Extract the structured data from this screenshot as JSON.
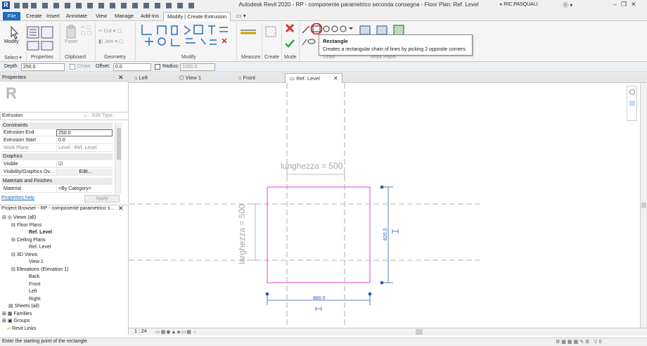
{
  "app": {
    "title": "Autodesk Revit 2020 - RP - componente parametrico seconda consegna - Floor Plan: Ref. Level",
    "user": "RIC.PASQUALI",
    "accent": "#1a6fc0"
  },
  "tabs": [
    "File",
    "Create",
    "Insert",
    "Annotate",
    "View",
    "Manage",
    "Add-Ins",
    "Modify | Create Extrusion"
  ],
  "ribbon": {
    "panels": [
      "Select",
      "Properties",
      "Clipboard",
      "Geometry",
      "Modify",
      "Measure",
      "Create",
      "Mode",
      "Draw",
      "Work Plane"
    ],
    "modify_label": "Modify",
    "properties_label": "Properties",
    "paste_label": "Paste",
    "cut_label": "Cut",
    "join_label": "Join"
  },
  "tooltip": {
    "title": "Rectangle",
    "text": "Creates a rectangular chain of lines by picking 2 opposite corners."
  },
  "options_bar": {
    "depth_label": "Depth",
    "depth_value": "250.0",
    "chain_label": "Chain",
    "offset_label": "Offset:",
    "offset_value": "0.0",
    "radius_label": "Radius:",
    "radius_value": "1000.0"
  },
  "properties": {
    "title": "Properties",
    "type": "Extrusion",
    "edit_type": "Edit Type",
    "sections": {
      "constraints": "Constraints",
      "graphics": "Graphics",
      "materials": "Materials and Finishes"
    },
    "rows": {
      "extrusion_end": {
        "label": "Extrusion End",
        "value": "250.0"
      },
      "extrusion_start": {
        "label": "Extrusion Start",
        "value": "0.0"
      },
      "work_plane": {
        "label": "Work Plane",
        "value": "Level : Ref. Level"
      },
      "visible": {
        "label": "Visible",
        "value": "☑"
      },
      "visibility": {
        "label": "Visibility/Graphics Ov...",
        "value": "Edit..."
      },
      "material": {
        "label": "Material",
        "value": "<By Category>"
      }
    },
    "help": "Properties help",
    "apply": "Apply"
  },
  "browser": {
    "title": "Project Browser - RP - componente parametrico s...",
    "items": [
      "Views (all)",
      "Floor Plans",
      "Ref. Level",
      "Ceiling Plans",
      "Ref. Level",
      "3D Views",
      "View 1",
      "Elevations (Elevation 1)",
      "Back",
      "Front",
      "Left",
      "Right",
      "Sheets (all)",
      "Families",
      "Groups",
      "Revit Links"
    ]
  },
  "view_tabs": [
    "Left",
    "View 1",
    "Front",
    "Ref. Level"
  ],
  "canvas": {
    "dim_top": "lunghezza = 500",
    "dim_left": "larghezza = 500",
    "dim_width": "880.0",
    "dim_height": "820.0"
  },
  "view_control": {
    "scale": "1 : 24"
  },
  "status": {
    "text": "Enter the starting point of the rectangle.",
    "filter_count": "0"
  }
}
